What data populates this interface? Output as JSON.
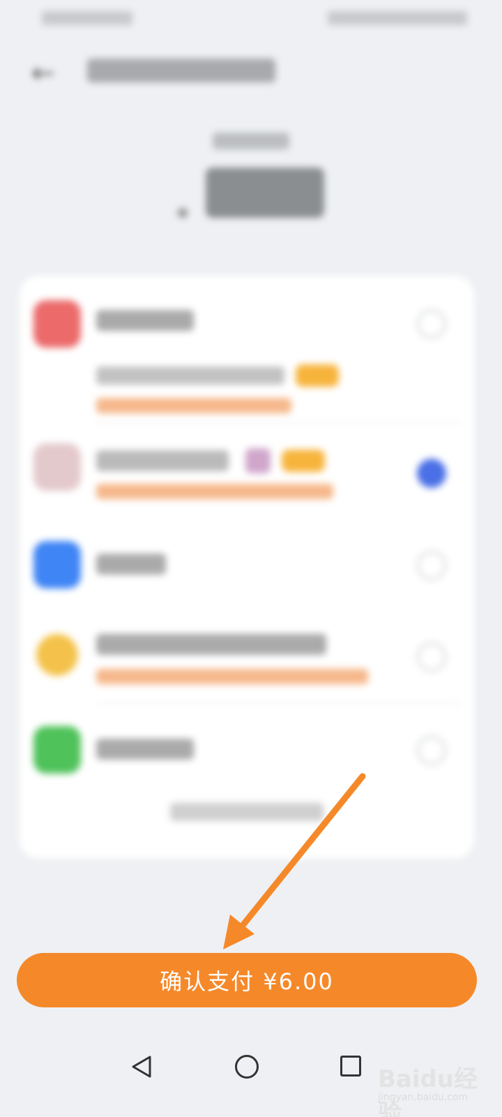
{
  "payment_screen": {
    "confirm_button_label": "确认支付 ¥6.00"
  },
  "watermark": {
    "brand": "Baidu经验",
    "url": "jingyan.baidu.com"
  },
  "colors": {
    "accent": "#f5892a",
    "selected_radio": "#4a6fe6",
    "promo_text": "#ee7e2c"
  },
  "icons": [
    "back-arrow-icon",
    "nav-back-icon",
    "nav-home-icon",
    "nav-recent-icon"
  ]
}
